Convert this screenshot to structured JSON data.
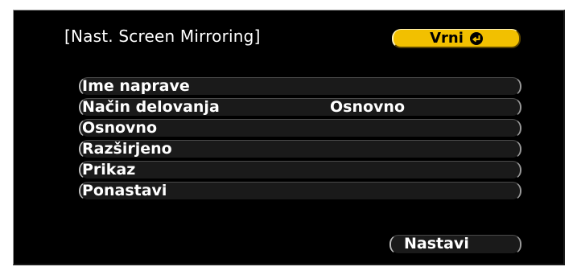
{
  "dialog": {
    "title": "[Nast. Screen Mirroring]",
    "back_label": "Vrni",
    "back_icon": "enter-key-icon"
  },
  "menu": {
    "items": [
      {
        "label": "Ime naprave",
        "value": ""
      },
      {
        "label": "Način delovanja",
        "value": "Osnovno"
      },
      {
        "label": "Osnovno",
        "value": ""
      },
      {
        "label": "Razširjeno",
        "value": ""
      },
      {
        "label": "Prikaz",
        "value": ""
      },
      {
        "label": "Ponastavi",
        "value": ""
      }
    ]
  },
  "footer": {
    "next_label": "Nastavi"
  },
  "colors": {
    "background": "#000000",
    "accent": "#f2c000",
    "row": "#1a1a1a",
    "text": "#ffffff"
  }
}
